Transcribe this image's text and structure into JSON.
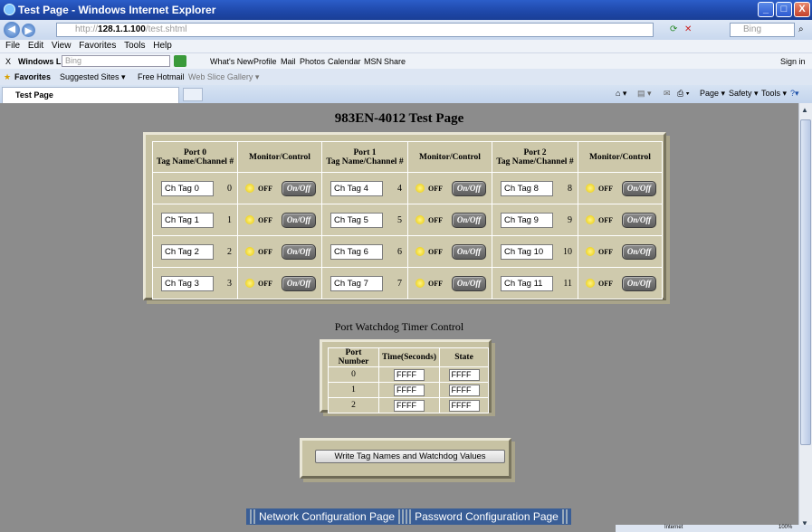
{
  "window": {
    "title": "Test Page - Windows Internet Explorer",
    "min": "_",
    "max": "□",
    "close": "X"
  },
  "address": {
    "url_prefix": "http://",
    "url_host": "128.1.1.100",
    "url_path": "/test.shtml",
    "search_placeholder": "Bing"
  },
  "menu": [
    "File",
    "Edit",
    "View",
    "Favorites",
    "Tools",
    "Help"
  ],
  "livebar": {
    "close": "X",
    "brand": "Windows Live",
    "search_placeholder": "Bing",
    "links": [
      "What's New",
      "Profile",
      "Mail",
      "Photos",
      "Calendar",
      "MSN",
      "Share"
    ],
    "sign_in": "Sign in"
  },
  "favbar": {
    "favorites": "Favorites",
    "suggested": "Suggested Sites ▾",
    "hotmail": "Free Hotmail",
    "gallery": "Web Slice Gallery ▾"
  },
  "tab": {
    "label": "Test Page",
    "tools": [
      "Page ▾",
      "Safety ▾",
      "Tools ▾",
      "?▾"
    ]
  },
  "page": {
    "title": "983EN-4012 Test Page",
    "headers": [
      "Port 0",
      "Port 1",
      "Port 2"
    ],
    "sub_header": "Tag Name/Channel #",
    "mc_header": "Monitor/Control",
    "rows": [
      [
        {
          "tag": "Ch Tag 0",
          "ch": "0"
        },
        {
          "tag": "Ch Tag 4",
          "ch": "4"
        },
        {
          "tag": "Ch Tag 8",
          "ch": "8"
        }
      ],
      [
        {
          "tag": "Ch Tag 1",
          "ch": "1"
        },
        {
          "tag": "Ch Tag 5",
          "ch": "5"
        },
        {
          "tag": "Ch Tag 9",
          "ch": "9"
        }
      ],
      [
        {
          "tag": "Ch Tag 2",
          "ch": "2"
        },
        {
          "tag": "Ch Tag 6",
          "ch": "6"
        },
        {
          "tag": "Ch Tag 10",
          "ch": "10"
        }
      ],
      [
        {
          "tag": "Ch Tag 3",
          "ch": "3"
        },
        {
          "tag": "Ch Tag 7",
          "ch": "7"
        },
        {
          "tag": "Ch Tag 11",
          "ch": "11"
        }
      ]
    ],
    "state_label": "OFF",
    "button_label": "On/Off",
    "watchdog_title": "Port Watchdog Timer Control",
    "watchdog_headers": [
      "Port Number",
      "Time(Seconds)",
      "State"
    ],
    "watchdog_rows": [
      {
        "port": "0",
        "time": "FFFF",
        "state": "FFFF"
      },
      {
        "port": "1",
        "time": "FFFF",
        "state": "FFFF"
      },
      {
        "port": "2",
        "time": "FFFF",
        "state": "FFFF"
      }
    ],
    "write_button": "Write Tag Names and Watchdog Values",
    "links": [
      "Network Configuration Page",
      "Password Configuration Page"
    ]
  },
  "status": {
    "zone": "Internet",
    "zoom": "100%"
  }
}
